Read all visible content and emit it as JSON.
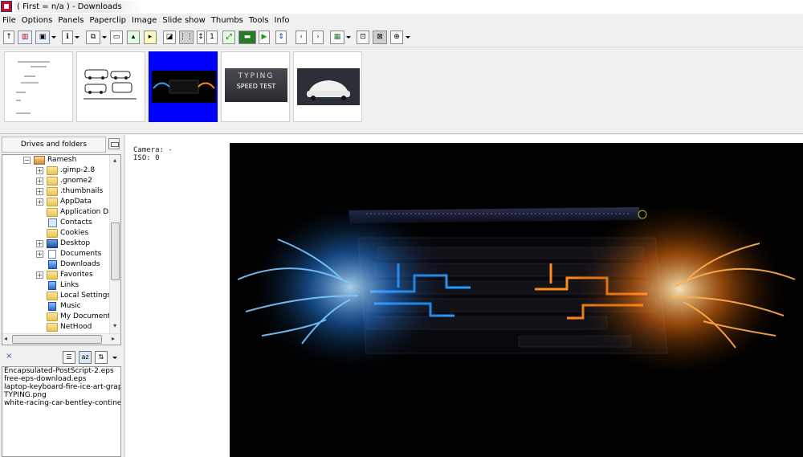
{
  "window": {
    "title": "( First = n/a ) - Downloads"
  },
  "menu": [
    "File",
    "Options",
    "Panels",
    "Paperclip",
    "Image",
    "Slide show",
    "Thumbs",
    "Tools",
    "Info"
  ],
  "toolbar_icons": [
    "up-arrow-icon",
    "browse-icon",
    "image-icon",
    "info-icon",
    "copy-icon",
    "page-icon",
    "export-icon",
    "slideshow-icon",
    "fullscreen-icon",
    "grid-icon",
    "one-to-one-icon",
    "fit-icon",
    "filmstrip-icon",
    "play-icon",
    "sort-updown-icon",
    "prev-icon",
    "next-icon",
    "settings-icon",
    "zoom-fit-icon",
    "zoom-actual-icon",
    "zoom-icon"
  ],
  "thumbnails": [
    {
      "name": "Encapsulated-PostScript-2.eps",
      "selected": false
    },
    {
      "name": "free-eps-download.eps",
      "selected": false
    },
    {
      "name": "laptop-keyboard-fire-ice-art-graphic",
      "selected": true
    },
    {
      "name": "TYPING.png",
      "selected": false,
      "text": "TYPING",
      "subtext": "SPEED TEST"
    },
    {
      "name": "white-racing-car-bentley-continental",
      "selected": false
    }
  ],
  "left_panel": {
    "header": "Drives and folders",
    "tree": [
      {
        "label": "Ramesh",
        "level": 0,
        "expander": "−",
        "icon": "user-folder-icon"
      },
      {
        "label": ".gimp-2.8",
        "level": 1,
        "expander": "+",
        "icon": "folder-icon"
      },
      {
        "label": ".gnome2",
        "level": 1,
        "expander": "+",
        "icon": "folder-icon"
      },
      {
        "label": ".thumbnails",
        "level": 1,
        "expander": "+",
        "icon": "folder-icon"
      },
      {
        "label": "AppData",
        "level": 1,
        "expander": "+",
        "icon": "folder-icon"
      },
      {
        "label": "Application Data",
        "level": 1,
        "expander": "",
        "icon": "folder-icon"
      },
      {
        "label": "Contacts",
        "level": 1,
        "expander": "",
        "icon": "contacts-icon"
      },
      {
        "label": "Cookies",
        "level": 1,
        "expander": "",
        "icon": "folder-icon"
      },
      {
        "label": "Desktop",
        "level": 1,
        "expander": "+",
        "icon": "desktop-icon"
      },
      {
        "label": "Documents",
        "level": 1,
        "expander": "+",
        "icon": "documents-icon"
      },
      {
        "label": "Downloads",
        "level": 1,
        "expander": "",
        "icon": "downloads-icon"
      },
      {
        "label": "Favorites",
        "level": 1,
        "expander": "+",
        "icon": "favorites-icon"
      },
      {
        "label": "Links",
        "level": 1,
        "expander": "",
        "icon": "links-icon"
      },
      {
        "label": "Local Settings",
        "level": 1,
        "expander": "",
        "icon": "folder-icon"
      },
      {
        "label": "Music",
        "level": 1,
        "expander": "",
        "icon": "music-icon"
      },
      {
        "label": "My Documents",
        "level": 1,
        "expander": "",
        "icon": "folder-icon"
      },
      {
        "label": "NetHood",
        "level": 1,
        "expander": "",
        "icon": "folder-icon"
      }
    ],
    "file_list_close": "×",
    "files": [
      "Encapsulated-PostScript-2.eps",
      "free-eps-download.eps",
      "laptop-keyboard-fire-ice-art-graphic-wi",
      "TYPING.png",
      "white-racing-car-bentley-continental-gt"
    ]
  },
  "main_view": {
    "info_lines": [
      "Camera: -",
      "ISO: 0"
    ]
  },
  "colors": {
    "selected_thumb": "#0000ff",
    "ice": "#3aa0ff",
    "fire": "#ff8a1a"
  }
}
